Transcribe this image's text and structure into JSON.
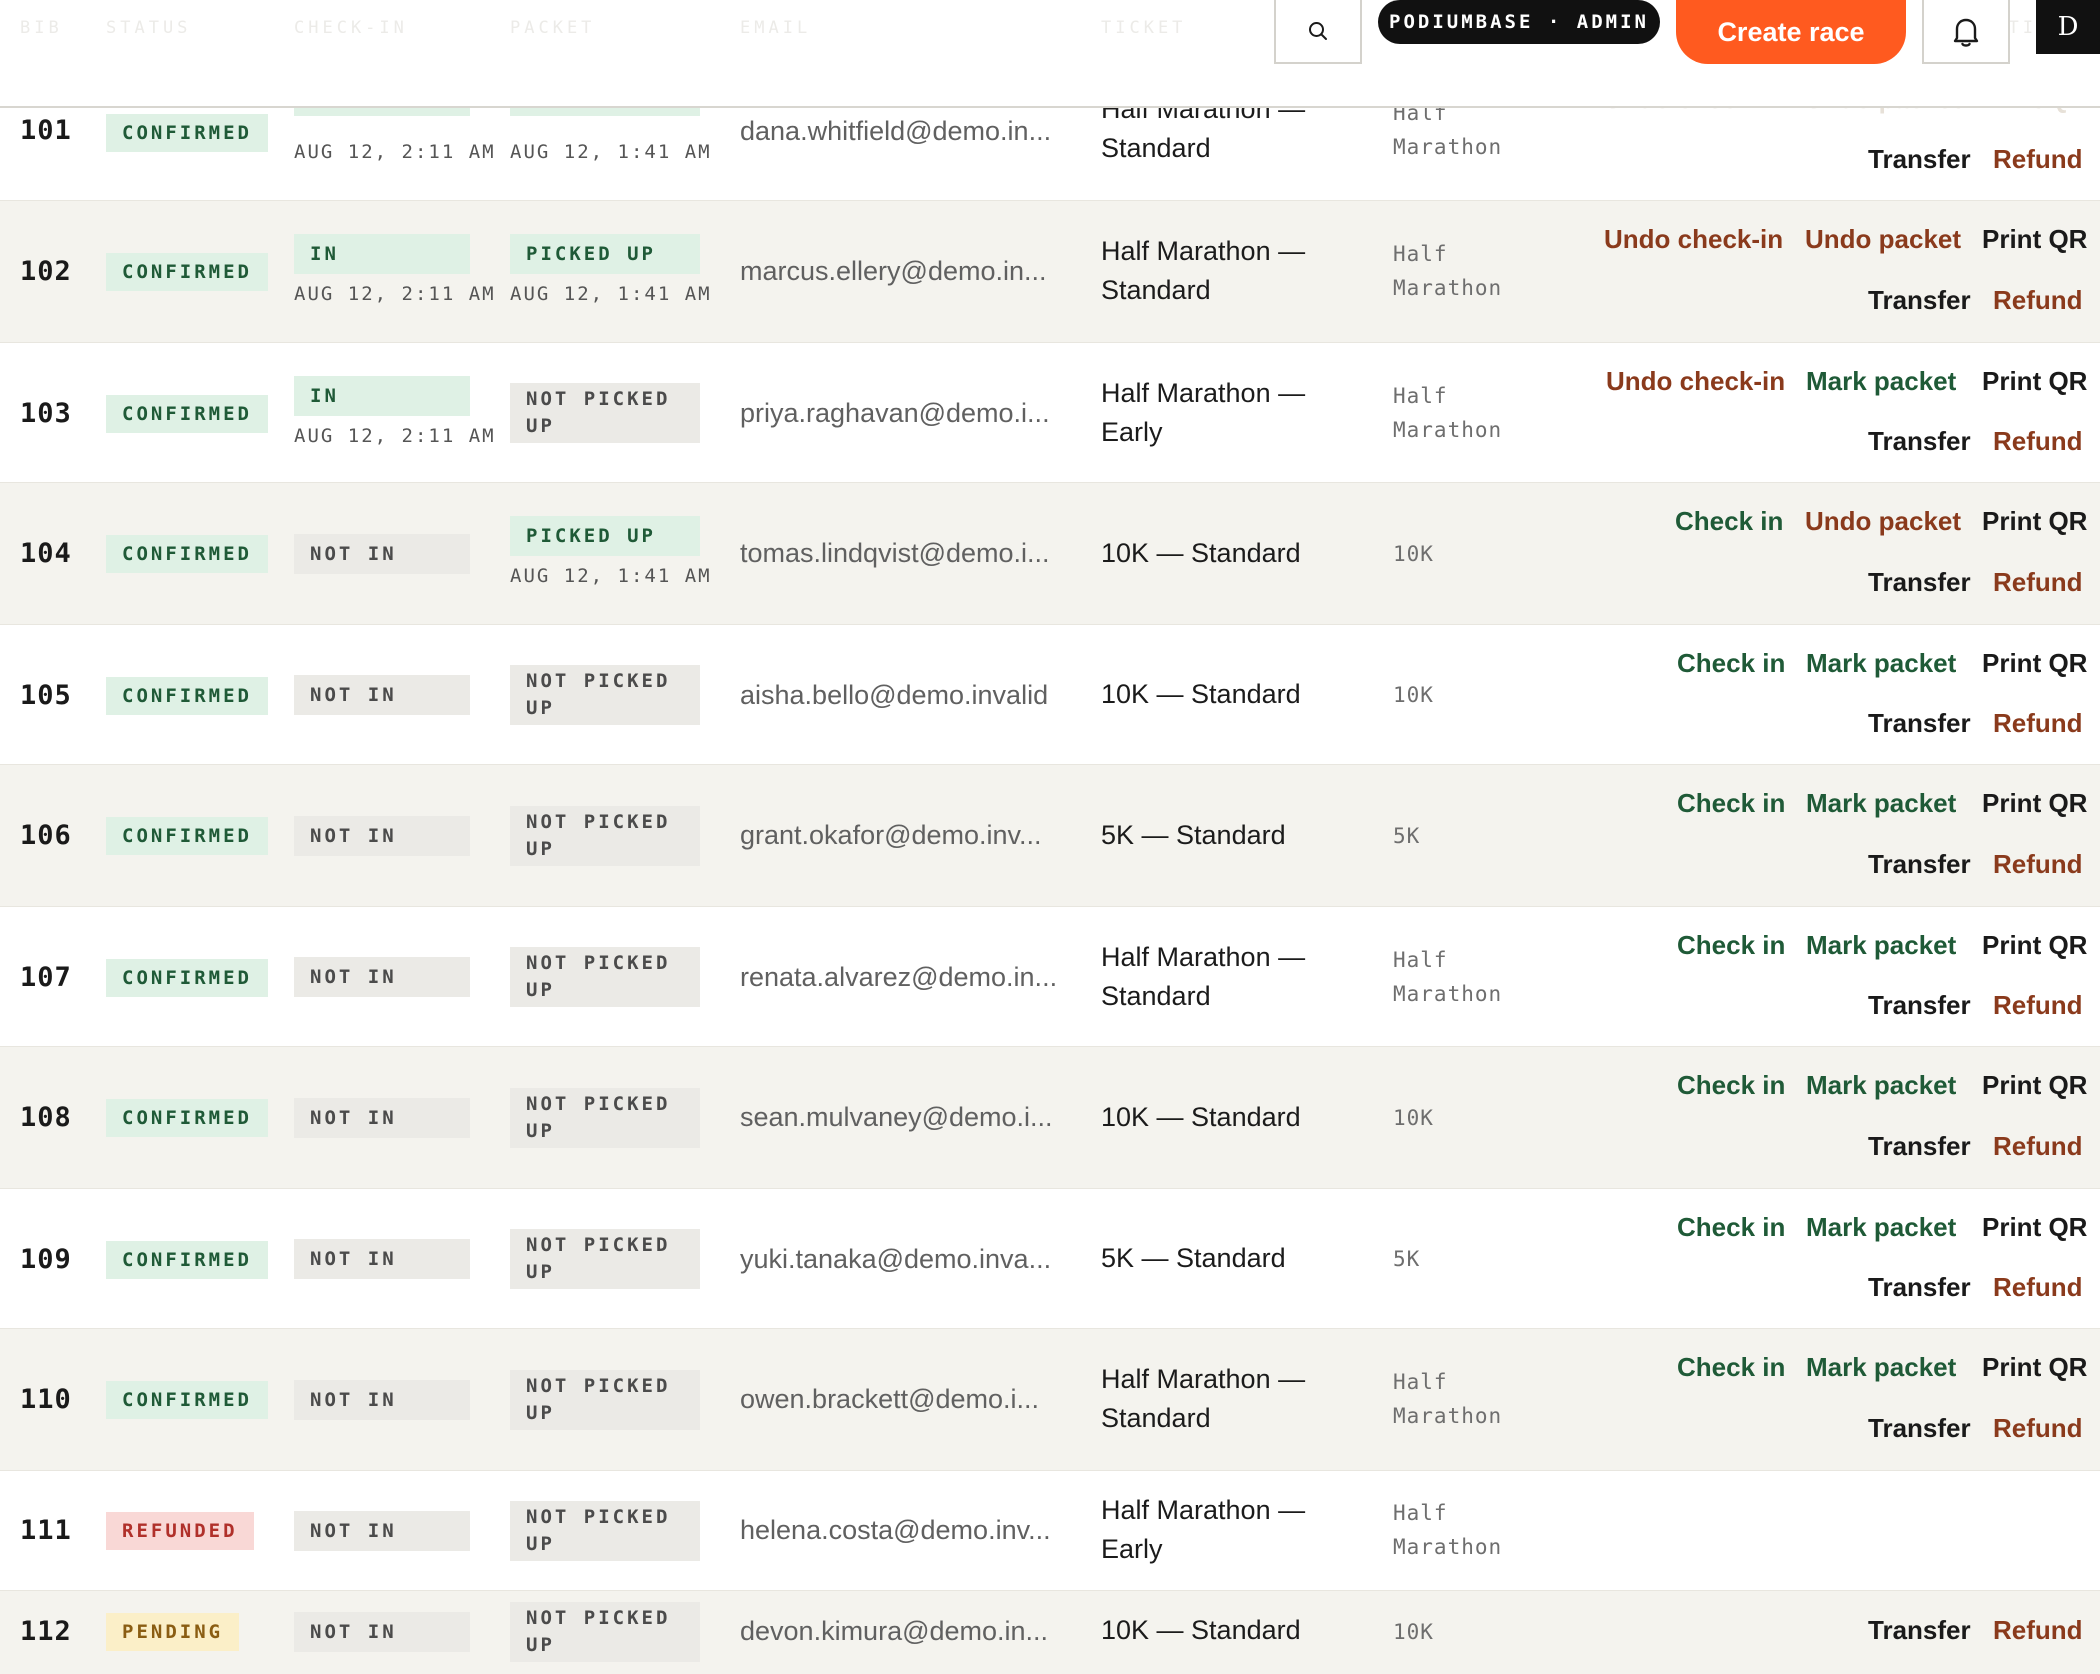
{
  "header": {
    "columns": [
      "BIB",
      "STATUS",
      "CHECK-IN",
      "PACKET",
      "EMAIL",
      "TICKET",
      "ACTIONS"
    ],
    "brand": "PODIUMBASE · ADMIN",
    "create_label": "Create race",
    "avatar_letter": "D",
    "icons": [
      "search-icon",
      "bell-icon"
    ]
  },
  "actions": {
    "check_in": "Check in",
    "undo_check_in": "Undo check-in",
    "mark_packet": "Mark packet",
    "undo_packet": "Undo packet",
    "print_qr": "Print QR",
    "transfer": "Transfer",
    "refund": "Refund"
  },
  "labels": {
    "confirmed": "CONFIRMED",
    "refunded": "REFUNDED",
    "pending": "PENDING",
    "in": "IN",
    "not_in": "NOT IN",
    "picked_up": "PICKED UP",
    "not_picked_1": "NOT PICKED",
    "not_picked_2": "UP"
  },
  "rows": [
    {
      "bib": "101",
      "checkin_time": "AUG 12, 2:11 AM",
      "packet_time": "AUG 12, 1:41 AM",
      "email": "dana.whitfield@demo.in...",
      "ticket_1": "Half Marathon —",
      "ticket_2": "Standard",
      "race_1": "Half",
      "race_2": "Marathon"
    },
    {
      "bib": "102",
      "checkin_time": "AUG 12, 2:11 AM",
      "packet_time": "AUG 12, 1:41 AM",
      "email": "marcus.ellery@demo.in...",
      "ticket_1": "Half Marathon —",
      "ticket_2": "Standard",
      "race_1": "Half",
      "race_2": "Marathon"
    },
    {
      "bib": "103",
      "checkin_time": "AUG 12, 2:11 AM",
      "email": "priya.raghavan@demo.i...",
      "ticket_1": "Half Marathon —",
      "ticket_2": "Early",
      "race_1": "Half",
      "race_2": "Marathon"
    },
    {
      "bib": "104",
      "packet_time": "AUG 12, 1:41 AM",
      "email": "tomas.lindqvist@demo.i...",
      "ticket_1": "10K — Standard",
      "race_1": "10K"
    },
    {
      "bib": "105",
      "email": "aisha.bello@demo.invalid",
      "ticket_1": "10K — Standard",
      "race_1": "10K"
    },
    {
      "bib": "106",
      "email": "grant.okafor@demo.inv...",
      "ticket_1": "5K — Standard",
      "race_1": "5K"
    },
    {
      "bib": "107",
      "email": "renata.alvarez@demo.in...",
      "ticket_1": "Half Marathon —",
      "ticket_2": "Standard",
      "race_1": "Half",
      "race_2": "Marathon"
    },
    {
      "bib": "108",
      "email": "sean.mulvaney@demo.i...",
      "ticket_1": "10K — Standard",
      "race_1": "10K"
    },
    {
      "bib": "109",
      "email": "yuki.tanaka@demo.inva...",
      "ticket_1": "5K — Standard",
      "race_1": "5K"
    },
    {
      "bib": "110",
      "email": "owen.brackett@demo.i...",
      "ticket_1": "Half Marathon —",
      "ticket_2": "Standard",
      "race_1": "Half",
      "race_2": "Marathon"
    },
    {
      "bib": "111",
      "email": "helena.costa@demo.inv...",
      "ticket_1": "Half Marathon —",
      "ticket_2": "Early",
      "race_1": "Half",
      "race_2": "Marathon"
    },
    {
      "bib": "112",
      "email": "devon.kimura@demo.in...",
      "ticket_1": "10K — Standard",
      "race_1": "10K"
    }
  ]
}
